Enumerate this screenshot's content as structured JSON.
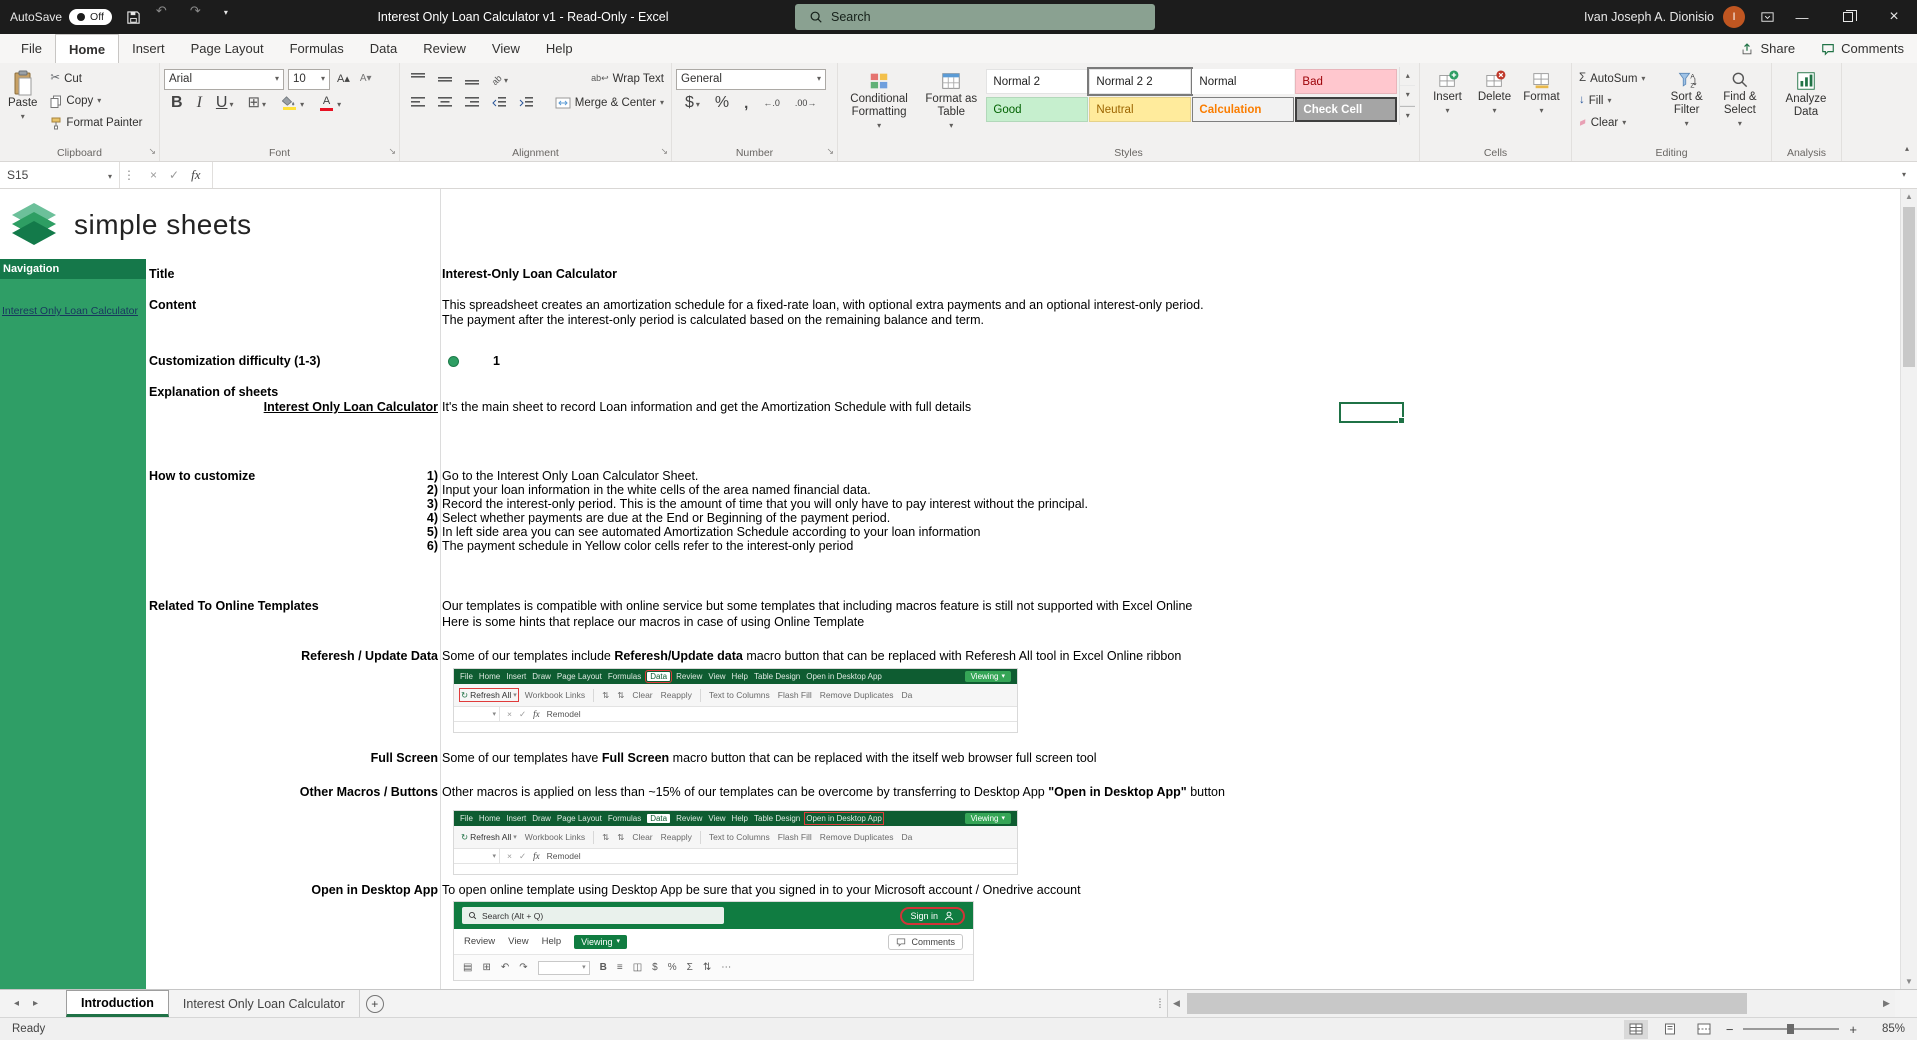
{
  "icons": {
    "dropdown_chevron": "▾",
    "undo": "↶",
    "redo": "↷",
    "refresh": "↻",
    "close": "×",
    "minimize": "—",
    "check": "✓",
    "cut_scissors": "✂",
    "autosum_sigma": "Σ",
    "borders_grid": "⊞"
  },
  "titlebar": {
    "autosave_label": "AutoSave",
    "autosave_state": "Off",
    "title": "Interest Only Loan Calculator v1 - Read-Only - Excel",
    "search_placeholder": "Search",
    "user_name": "Ivan Joseph A. Dionisio",
    "user_initial": "I"
  },
  "ribbon": {
    "tabs": [
      "File",
      "Home",
      "Insert",
      "Page Layout",
      "Formulas",
      "Data",
      "Review",
      "View",
      "Help"
    ],
    "share": "Share",
    "comments": "Comments",
    "clipboard": {
      "label": "Clipboard",
      "paste": "Paste",
      "cut": "Cut",
      "copy": "Copy",
      "format_painter": "Format Painter"
    },
    "font": {
      "label": "Font",
      "family": "Arial",
      "size": "10"
    },
    "alignment": {
      "label": "Alignment",
      "wrap": "Wrap Text",
      "merge": "Merge & Center"
    },
    "number": {
      "label": "Number",
      "format": "General"
    },
    "styles": {
      "label": "Styles",
      "conditional": "Conditional Formatting",
      "format_table": "Format as Table",
      "cells": [
        "Normal 2",
        "Normal 2 2",
        "Normal",
        "Bad",
        "Good",
        "Neutral",
        "Calculation",
        "Check Cell"
      ]
    },
    "cells": {
      "label": "Cells",
      "insert": "Insert",
      "delete": "Delete",
      "format": "Format"
    },
    "editing": {
      "label": "Editing",
      "autosum": "AutoSum",
      "fill": "Fill",
      "clear": "Clear",
      "sort": "Sort & Filter",
      "find": "Find & Select"
    },
    "analysis": {
      "label": "Analysis",
      "analyze": "Analyze Data"
    }
  },
  "formula_bar": {
    "name_box": "S15",
    "fx": "fx"
  },
  "sheet": {
    "logo_text": "simple sheets",
    "nav_header": "Navigation",
    "nav_link": "Interest Only Loan Calculator",
    "rows": {
      "title": {
        "label": "Title",
        "value": "Interest-Only Loan Calculator"
      },
      "content": {
        "label": "Content",
        "line1": "This spreadsheet creates an amortization schedule for a fixed-rate loan, with optional extra payments and an optional interest-only period.",
        "line2": "The payment after the interest-only period is calculated based on the remaining balance and term."
      },
      "difficulty": {
        "label": "Customization difficulty (1-3)",
        "value": "1"
      },
      "explanation": {
        "label": "Explanation of sheets"
      },
      "main_sheet": {
        "label": "Interest Only Loan Calculator",
        "value": "It's the main sheet to record Loan information and get the Amortization Schedule with full details"
      },
      "how_to": {
        "label": "How to customize",
        "steps": [
          {
            "num": "1)",
            "text": "Go to the Interest Only Loan Calculator Sheet."
          },
          {
            "num": "2)",
            "text": "Input your loan information in the white cells of the area named financial data."
          },
          {
            "num": "3)",
            "text": "Record the interest-only period. This is the amount of time that you will only have to pay interest without the principal."
          },
          {
            "num": "4)",
            "text": "Select whether payments are due at the End or Beginning of the payment period."
          },
          {
            "num": "5)",
            "text": "In left side area you can see automated Amortization Schedule according to your loan information"
          },
          {
            "num": "6)",
            "text": "The payment schedule in Yellow color cells refer to the interest-only period"
          }
        ]
      },
      "related": {
        "label": "Related To Online Templates",
        "line1": "Our templates is compatible with online service but some templates that including macros feature is still not supported with Excel Online",
        "line2": "Here is some hints that replace our macros in case of using Online Template"
      },
      "refresh": {
        "label": "Referesh / Update Data",
        "pre": "Some of our templates include ",
        "bold": "Referesh/Update data",
        "post": " macro button that can be replaced with Referesh All tool in Excel Online ribbon"
      },
      "fullscreen": {
        "label": "Full Screen",
        "pre": "Some of our templates have ",
        "bold": "Full Screen",
        "post": " macro button that can be replaced with the itself web browser full screen tool"
      },
      "other_macros": {
        "label": "Other Macros / Buttons",
        "pre": "Other macros is applied on less than ~15% of our templates can be overcome by transferring to Desktop App ",
        "bold": "\"Open in Desktop App\"",
        "post": " button"
      },
      "open_desktop": {
        "label": "Open in Desktop App",
        "value": "To open online template using Desktop App be sure that you signed in to your Microsoft account / Onedrive account"
      }
    },
    "online_ribbon": {
      "tabs": [
        "File",
        "Home",
        "Insert",
        "Draw",
        "Page Layout",
        "Formulas",
        "Data",
        "Review",
        "View",
        "Help",
        "Table Design",
        "Open in Desktop App"
      ],
      "viewing": "Viewing",
      "refresh_all": "Refresh All",
      "workbook_links": "Workbook Links",
      "clear": "Clear",
      "reapply": "Reapply",
      "text_to_columns": "Text to Columns",
      "flash_fill": "Flash Fill",
      "remove_duplicates": "Remove Duplicates",
      "da": "Da",
      "fx": "fx",
      "formula_text": "Remodel"
    },
    "online_signin": {
      "search_placeholder": "Search (Alt + Q)",
      "sign_in": "Sign in",
      "menu": [
        "Review",
        "View",
        "Help"
      ],
      "viewing": "Viewing",
      "comments": "Comments"
    }
  },
  "sheet_tabs": {
    "tabs": [
      "Introduction",
      "Interest Only Loan Calculator"
    ]
  },
  "status_bar": {
    "ready": "Ready",
    "zoom": "85%"
  }
}
